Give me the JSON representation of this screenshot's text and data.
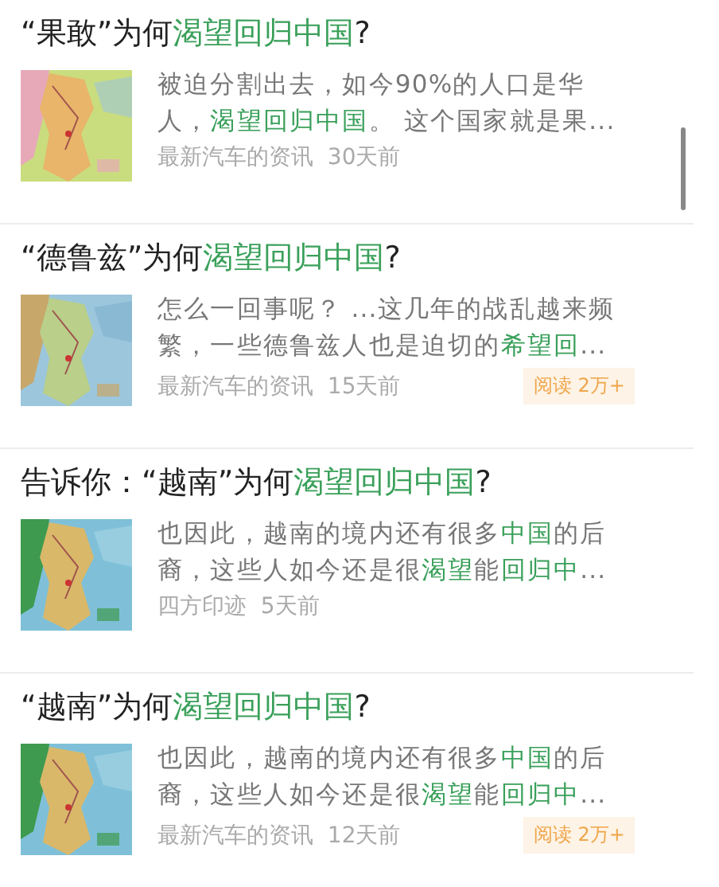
{
  "articles": [
    {
      "title": [
        {
          "text": "“果敢”为何",
          "highlight": false
        },
        {
          "text": "渴望回归中国",
          "highlight": true
        },
        {
          "text": "?",
          "highlight": false
        }
      ],
      "thumbnail": {
        "kind": "picture"
      },
      "snippet": [
        {
          "text": "被迫分割出去，如今90%的人口是华人，",
          "highlight": false
        },
        {
          "text": "渴望回归中国",
          "highlight": true
        },
        {
          "text": "。 这个国家就是果...",
          "highlight": false
        }
      ],
      "source": "最新汽车的资讯",
      "time": "30天前"
    },
    {
      "title": [
        {
          "text": "“德鲁兹”为何",
          "highlight": false
        },
        {
          "text": "渴望回归中国",
          "highlight": true
        },
        {
          "text": "?",
          "highlight": false
        }
      ],
      "thumbnail": {
        "kind": "picture"
      },
      "snippet": [
        {
          "text": "怎么一回事呢？ ...这几年的战乱越来频繁，一些德鲁兹人也是迫切的",
          "highlight": false
        },
        {
          "text": "希望回",
          "highlight": true
        },
        {
          "text": "...",
          "highlight": false
        }
      ],
      "source": "最新汽车的资讯",
      "time": "15天前",
      "reads": "阅读 2万+"
    },
    {
      "title": [
        {
          "text": "告诉你：“越南”为何",
          "highlight": false
        },
        {
          "text": "渴望回归中国",
          "highlight": true
        },
        {
          "text": "?",
          "highlight": false
        }
      ],
      "thumbnail": {
        "kind": "picture"
      },
      "snippet": [
        {
          "text": "也因此，越南的境内还有很多",
          "highlight": false
        },
        {
          "text": "中国",
          "highlight": true
        },
        {
          "text": "的后裔，这些人如今还是很",
          "highlight": false
        },
        {
          "text": "渴望",
          "highlight": true
        },
        {
          "text": "能",
          "highlight": false
        },
        {
          "text": "回归中",
          "highlight": true
        },
        {
          "text": "...",
          "highlight": false
        }
      ],
      "source": "四方印迹",
      "time": "5天前"
    },
    {
      "title": [
        {
          "text": "“越南”为何",
          "highlight": false
        },
        {
          "text": "渴望回归中国",
          "highlight": true
        },
        {
          "text": "?",
          "highlight": false
        }
      ],
      "thumbnail": {
        "kind": "picture"
      },
      "snippet": [
        {
          "text": "也因此，越南的境内还有很多",
          "highlight": false
        },
        {
          "text": "中国",
          "highlight": true
        },
        {
          "text": "的后裔，这些人如今还是很",
          "highlight": false
        },
        {
          "text": "渴望",
          "highlight": true
        },
        {
          "text": "能",
          "highlight": false
        },
        {
          "text": "回归中",
          "highlight": true
        },
        {
          "text": "...",
          "highlight": false
        }
      ],
      "source": "最新汽车的资讯",
      "time": "12天前",
      "reads": "阅读 2万+"
    }
  ]
}
